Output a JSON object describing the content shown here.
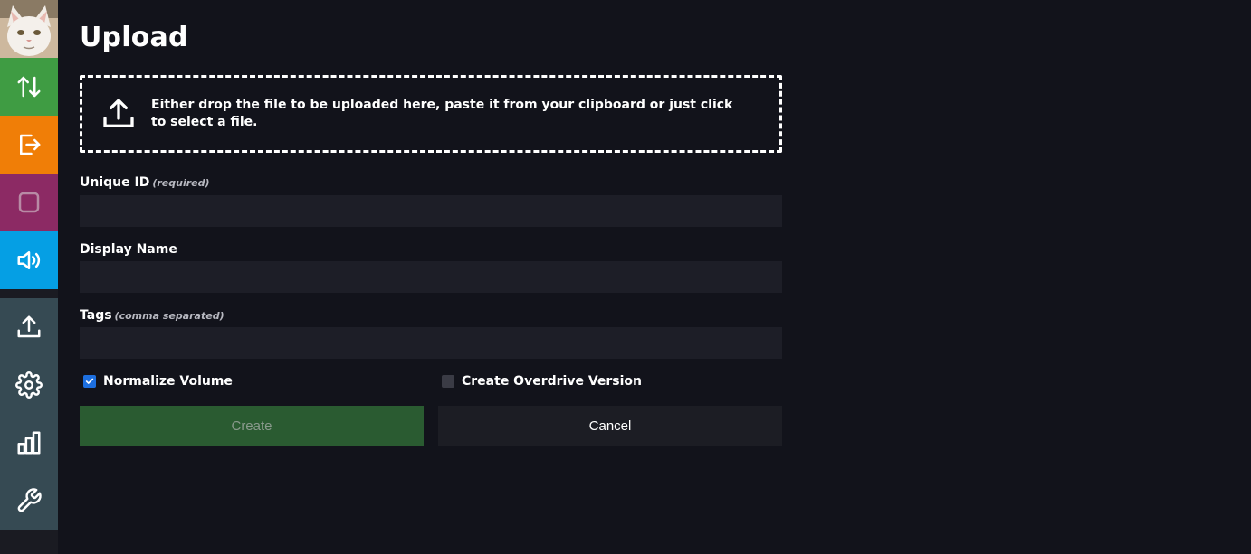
{
  "page": {
    "title": "Upload"
  },
  "sidebar": {
    "items": [
      {
        "name": "swap",
        "icon": "arrows-up-down-icon",
        "color": "#3f9c43"
      },
      {
        "name": "logout",
        "icon": "logout-icon",
        "color": "#f07e07"
      },
      {
        "name": "stop",
        "icon": "stop-square-icon",
        "color": "#8c2a64"
      },
      {
        "name": "volume",
        "icon": "volume-icon",
        "color": "#059fe4"
      },
      {
        "name": "upload",
        "icon": "upload-icon",
        "color": "#364a53"
      },
      {
        "name": "settings",
        "icon": "gear-icon",
        "color": "#364a53"
      },
      {
        "name": "stats",
        "icon": "bar-chart-icon",
        "color": "#364a53"
      },
      {
        "name": "tools",
        "icon": "wrench-icon",
        "color": "#364a53"
      }
    ]
  },
  "dropzone": {
    "text": "Either drop the file to be uploaded here, paste it from your clipboard or just click to select a file."
  },
  "form": {
    "unique_id": {
      "label": "Unique ID",
      "hint": "(required)",
      "value": ""
    },
    "display_name": {
      "label": "Display Name",
      "value": ""
    },
    "tags": {
      "label": "Tags",
      "hint": "(comma separated)",
      "value": ""
    },
    "normalize_volume": {
      "label": "Normalize Volume",
      "checked": true
    },
    "overdrive": {
      "label": "Create Overdrive Version",
      "checked": false
    }
  },
  "buttons": {
    "create": "Create",
    "cancel": "Cancel"
  }
}
